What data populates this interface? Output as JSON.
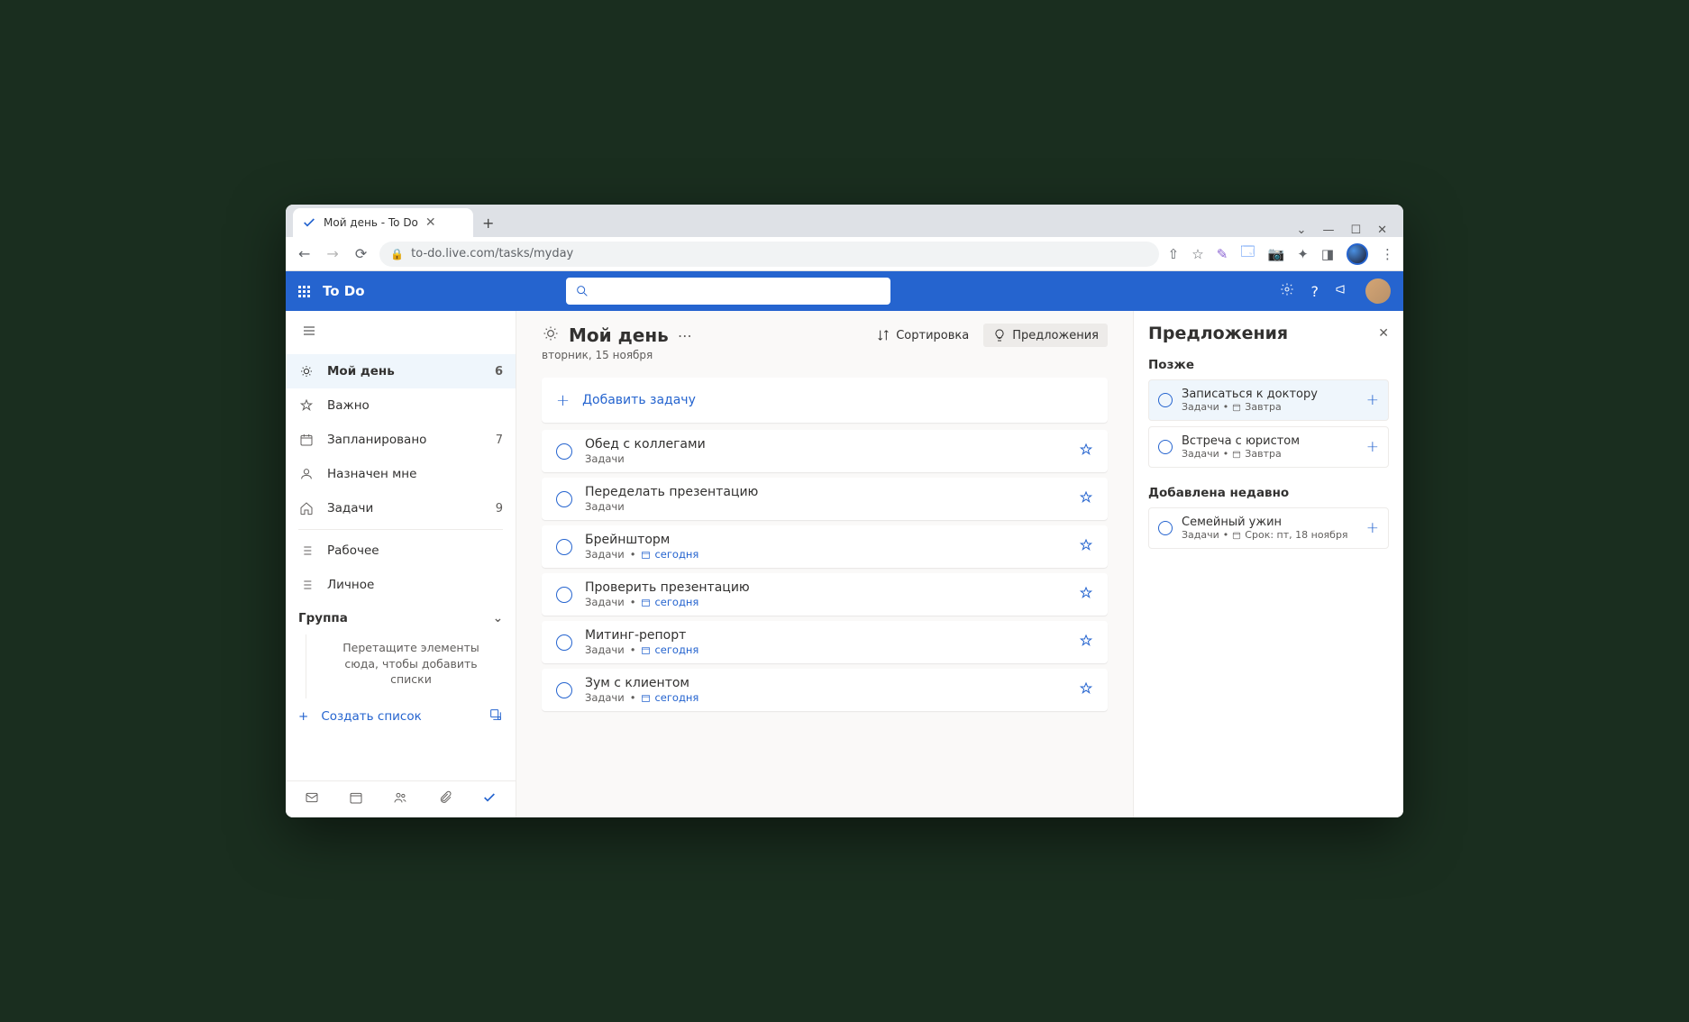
{
  "browser": {
    "tab_title": "Мой день - To Do",
    "url": "to-do.live.com/tasks/myday"
  },
  "app": {
    "title": "To Do"
  },
  "sidebar": {
    "items": [
      {
        "label": "Мой день",
        "count": "6",
        "active": true
      },
      {
        "label": "Важно",
        "count": ""
      },
      {
        "label": "Запланировано",
        "count": "7"
      },
      {
        "label": "Назначен мне",
        "count": ""
      },
      {
        "label": "Задачи",
        "count": "9"
      }
    ],
    "custom": [
      {
        "label": "Рабочее"
      },
      {
        "label": "Личное"
      }
    ],
    "group_label": "Группа",
    "group_hint": "Перетащите элементы сюда, чтобы добавить списки",
    "create_list": "Создать список"
  },
  "main": {
    "title": "Мой день",
    "date": "вторник, 15 ноября",
    "sort_label": "Сортировка",
    "suggestions_label": "Предложения",
    "add_task": "Добавить задачу",
    "tasks": [
      {
        "title": "Обед с коллегами",
        "list": "Задачи",
        "due": ""
      },
      {
        "title": "Переделать презентацию",
        "list": "Задачи",
        "due": ""
      },
      {
        "title": "Брейншторм",
        "list": "Задачи",
        "due": "сегодня"
      },
      {
        "title": "Проверить презентацию",
        "list": "Задачи",
        "due": "сегодня"
      },
      {
        "title": "Митинг-репорт",
        "list": "Задачи",
        "due": "сегодня"
      },
      {
        "title": "Зум с клиентом",
        "list": "Задачи",
        "due": "сегодня"
      }
    ]
  },
  "suggestions": {
    "title": "Предложения",
    "sections": [
      {
        "label": "Позже",
        "items": [
          {
            "title": "Записаться к доктору",
            "list": "Задачи",
            "due": "Завтра",
            "highlight": true
          },
          {
            "title": "Встреча с юристом",
            "list": "Задачи",
            "due": "Завтра"
          }
        ]
      },
      {
        "label": "Добавлена недавно",
        "items": [
          {
            "title": "Семейный ужин",
            "list": "Задачи",
            "due": "Срок: пт, 18 ноября"
          }
        ]
      }
    ]
  }
}
